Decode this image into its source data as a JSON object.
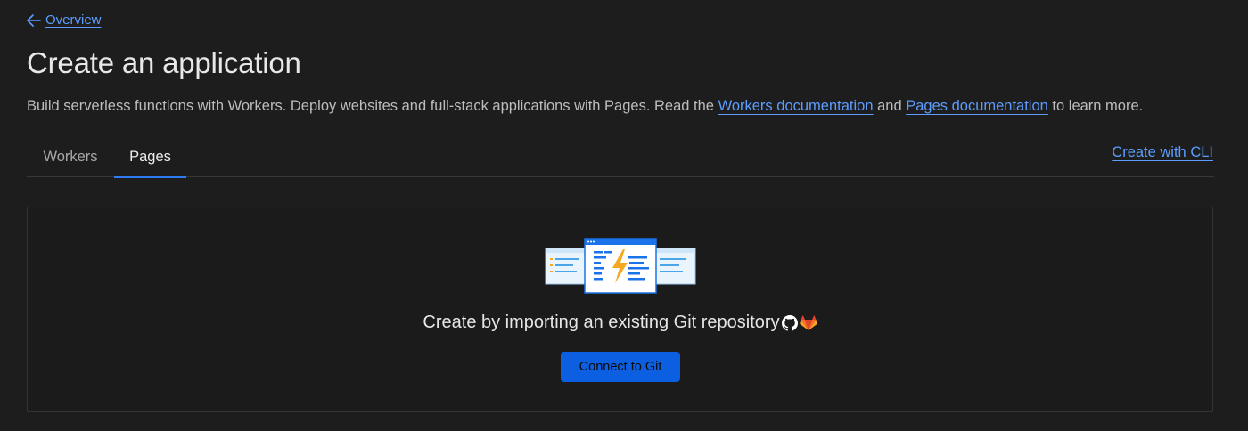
{
  "nav": {
    "back_label": "Overview"
  },
  "header": {
    "title": "Create an application",
    "subtitle_prefix": "Build serverless functions with Workers. Deploy websites and full-stack applications with Pages. Read the ",
    "workers_docs_label": "Workers documentation",
    "subtitle_and": " and ",
    "pages_docs_label": "Pages documentation",
    "subtitle_suffix": " to learn more."
  },
  "tabs": [
    {
      "label": "Workers",
      "active": false
    },
    {
      "label": "Pages",
      "active": true
    }
  ],
  "cli_link_label": "Create with CLI",
  "card": {
    "prompt": "Create by importing an existing Git repository",
    "icons": [
      "github-icon",
      "gitlab-icon"
    ],
    "button_label": "Connect to Git"
  },
  "colors": {
    "background": "#1d1d1d",
    "link": "#5c9dff",
    "accent": "#2f7bf5",
    "button": "#0b5fe0",
    "lightning": "#f6a821",
    "gitlab": "#e2572c"
  }
}
